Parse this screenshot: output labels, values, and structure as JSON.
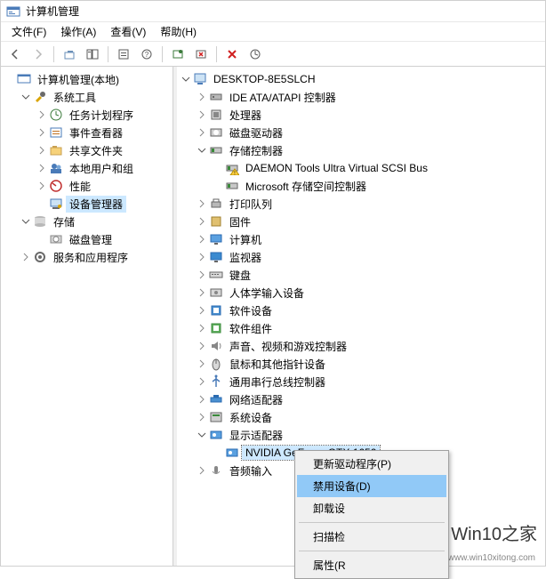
{
  "title": "计算机管理",
  "menubar": [
    "文件(F)",
    "操作(A)",
    "查看(V)",
    "帮助(H)"
  ],
  "left_tree": {
    "root": "计算机管理(本地)",
    "groups": [
      {
        "label": "系统工具",
        "expanded": true,
        "icon": "tools-icon",
        "children": [
          {
            "label": "任务计划程序",
            "icon": "clock-icon",
            "hasChildren": true
          },
          {
            "label": "事件查看器",
            "icon": "event-icon",
            "hasChildren": true
          },
          {
            "label": "共享文件夹",
            "icon": "share-icon",
            "hasChildren": true
          },
          {
            "label": "本地用户和组",
            "icon": "users-icon",
            "hasChildren": true
          },
          {
            "label": "性能",
            "icon": "perf-icon",
            "hasChildren": true
          },
          {
            "label": "设备管理器",
            "icon": "device-mgr-icon",
            "selected": true
          }
        ]
      },
      {
        "label": "存储",
        "expanded": true,
        "icon": "storage-icon",
        "children": [
          {
            "label": "磁盘管理",
            "icon": "disk-icon"
          }
        ]
      },
      {
        "label": "服务和应用程序",
        "icon": "services-icon",
        "hasChildren": true
      }
    ]
  },
  "right_tree": {
    "root": "DESKTOP-8E5SLCH",
    "items": [
      {
        "label": "IDE ATA/ATAPI 控制器",
        "icon": "controller-icon",
        "hasChildren": true
      },
      {
        "label": "处理器",
        "icon": "cpu-icon",
        "hasChildren": true
      },
      {
        "label": "磁盘驱动器",
        "icon": "hdd-icon",
        "hasChildren": true
      },
      {
        "label": "存储控制器",
        "icon": "storage-ctrl-icon",
        "expanded": true,
        "children": [
          {
            "label": "DAEMON Tools Ultra Virtual SCSI Bus",
            "icon": "daemon-icon"
          },
          {
            "label": "Microsoft 存储空间控制器",
            "icon": "storage-ctrl-icon"
          }
        ]
      },
      {
        "label": "打印队列",
        "icon": "printer-icon",
        "hasChildren": true
      },
      {
        "label": "固件",
        "icon": "firmware-icon",
        "hasChildren": true
      },
      {
        "label": "计算机",
        "icon": "monitor-icon",
        "hasChildren": true
      },
      {
        "label": "监视器",
        "icon": "display-icon",
        "hasChildren": true
      },
      {
        "label": "键盘",
        "icon": "keyboard-icon",
        "hasChildren": true
      },
      {
        "label": "人体学输入设备",
        "icon": "hid-icon",
        "hasChildren": true
      },
      {
        "label": "软件设备",
        "icon": "software-icon",
        "hasChildren": true
      },
      {
        "label": "软件组件",
        "icon": "component-icon",
        "hasChildren": true
      },
      {
        "label": "声音、视频和游戏控制器",
        "icon": "audio-icon",
        "hasChildren": true
      },
      {
        "label": "鼠标和其他指针设备",
        "icon": "mouse-icon",
        "hasChildren": true
      },
      {
        "label": "通用串行总线控制器",
        "icon": "usb-icon",
        "hasChildren": true
      },
      {
        "label": "网络适配器",
        "icon": "network-icon",
        "hasChildren": true
      },
      {
        "label": "系统设备",
        "icon": "system-icon",
        "hasChildren": true
      },
      {
        "label": "显示适配器",
        "icon": "gpu-icon",
        "expanded": true,
        "children": [
          {
            "label": "NVIDIA GeForce GTX 1650",
            "icon": "gpu-icon",
            "selected": true
          }
        ]
      },
      {
        "label": "音频输入",
        "icon": "audio-in-icon",
        "hasChildren": true
      }
    ]
  },
  "context_menu": {
    "items": [
      {
        "label": "更新驱动程序(P)"
      },
      {
        "label": "禁用设备(D)",
        "highlight": true
      },
      {
        "label": "卸载设"
      },
      {
        "sep": true
      },
      {
        "label": "扫描检"
      },
      {
        "sep": true
      },
      {
        "label": "属性(R"
      }
    ]
  },
  "watermark": {
    "brand": "Win10之家",
    "url": "www.win10xitong.com"
  }
}
